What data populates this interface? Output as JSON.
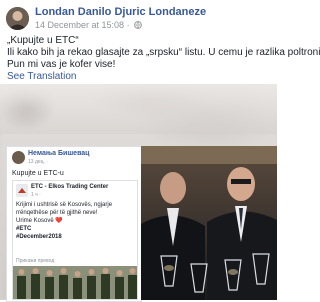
{
  "post": {
    "author": "Londan Danilo Djuric Londaneze",
    "timestamp": "14 December at 15:08",
    "separator": "·",
    "lines": [
      "„Kupujte u ETC“",
      "Ili kako bih ja rekao glasajte za „srpsku“ listu. U cemu je razlika poltroni?",
      "Pun mi vas je kofer vise!"
    ],
    "see_translation": "See Translation"
  },
  "shared_post": {
    "author": "Немања Бишевац",
    "meta": "13 дец. · ",
    "text": "Kupujte u ETC-u",
    "page": {
      "name": "ETC - Elkos Trading Center",
      "meta": "1 ч · ",
      "lines": [
        "Krijimi i ushtrisë së Kosovës, ngjarje",
        "rrënqethëse për të gjithë neve!",
        "Urime Kosovë ❤️"
      ],
      "hashtags": [
        "#ETC",
        "#December2018"
      ],
      "translation_label": "Прикажи превод"
    }
  },
  "colors": {
    "link": "#385898",
    "meta": "#90949c",
    "text": "#1d2129"
  }
}
